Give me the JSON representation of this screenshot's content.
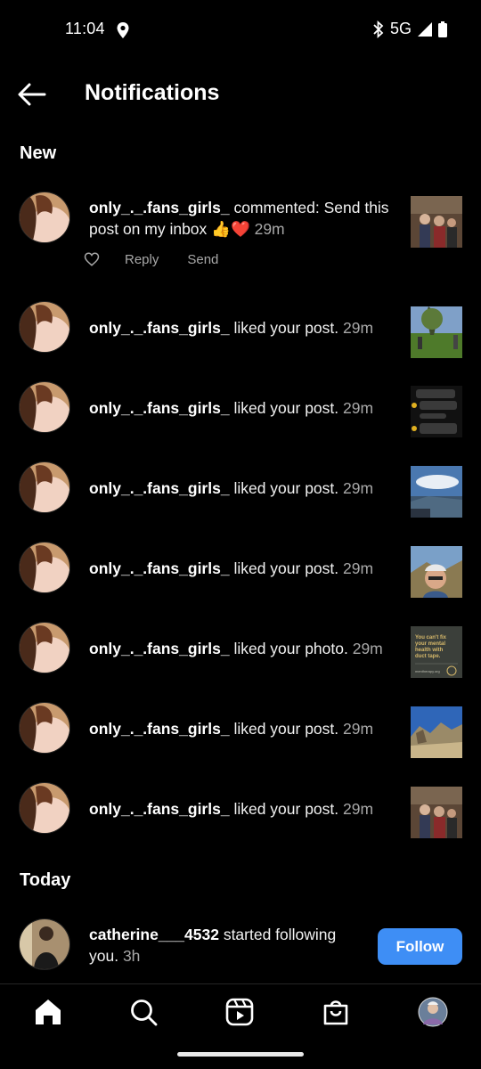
{
  "status_bar": {
    "time": "11:04",
    "network": "5G"
  },
  "header": {
    "title": "Notifications"
  },
  "sections": {
    "new": "New",
    "today": "Today"
  },
  "notifications": [
    {
      "username": "only_._.fans_girls_",
      "action": " commented: Send this post on my inbox 👍❤️",
      "time": " 29m",
      "thumb": "thumb-group-photo"
    },
    {
      "username": "only_._.fans_girls_",
      "action": " liked your post.",
      "time": " 29m",
      "thumb": "thumb-park"
    },
    {
      "username": "only_._.fans_girls_",
      "action": " liked your post.",
      "time": " 29m",
      "thumb": "thumb-chat-screenshot"
    },
    {
      "username": "only_._.fans_girls_",
      "action": " liked your post.",
      "time": " 29m",
      "thumb": "thumb-lake"
    },
    {
      "username": "only_._.fans_girls_",
      "action": " liked your post.",
      "time": " 29m",
      "thumb": "thumb-selfie"
    },
    {
      "username": "only_._.fans_girls_",
      "action": " liked your photo.",
      "time": " 29m",
      "thumb": "thumb-quote-card"
    },
    {
      "username": "only_._.fans_girls_",
      "action": " liked your post.",
      "time": " 29m",
      "thumb": "thumb-rocks"
    },
    {
      "username": "only_._.fans_girls_",
      "action": " liked your post.",
      "time": " 29m",
      "thumb": "thumb-group-photo"
    }
  ],
  "comment_actions": {
    "reply": "Reply",
    "send": "Send"
  },
  "quote_card": {
    "text": "You can't fix your mental health with duct tape.",
    "site": "mentherapy.org"
  },
  "today_notification": {
    "username": "catherine___4532",
    "action": " started following you.",
    "time": " 3h",
    "follow_label": "Follow"
  },
  "colors": {
    "background": "#000000",
    "follow_button": "#3e8ef5",
    "secondary_text": "#a8a8a8",
    "heart": "#e0245e"
  },
  "nav": [
    "home-icon",
    "search-icon",
    "reels-icon",
    "shop-icon",
    "profile-avatar"
  ]
}
